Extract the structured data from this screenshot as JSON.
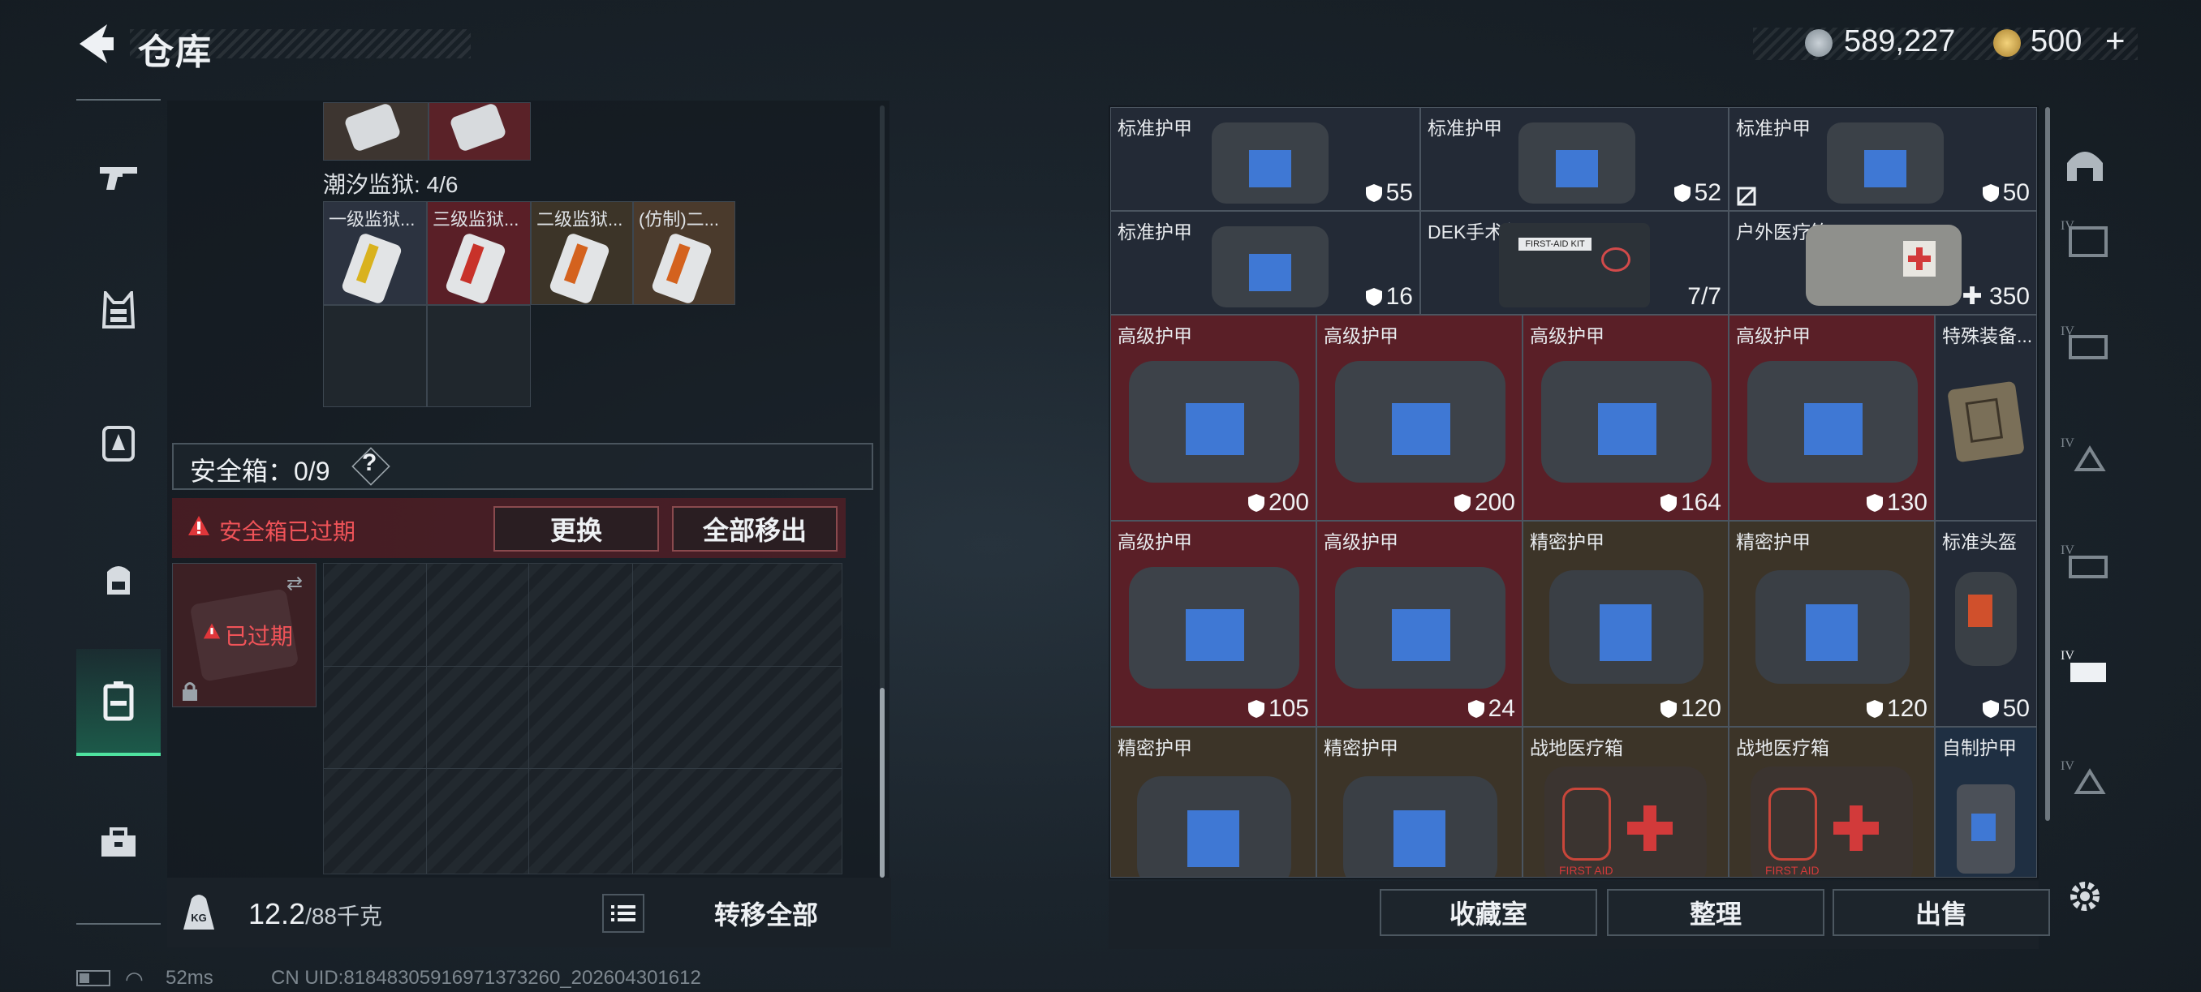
{
  "header": {
    "title": "仓库",
    "currency_silver": "589,227",
    "currency_gold": "500"
  },
  "sidebar": {
    "items": [
      "gun-icon",
      "vest-icon",
      "chest-rig-icon",
      "backpack-icon",
      "safe-box-icon",
      "toolbox-icon"
    ]
  },
  "left": {
    "prison_label": "潮汐监狱: 4/6",
    "cards": [
      "一级监狱...",
      "三级监狱...",
      "二级监狱...",
      "(仿制)二..."
    ],
    "safebox_label": "安全箱：0/9",
    "help": "?",
    "expired_warning": "安全箱已过期",
    "replace_button": "更换",
    "remove_all_button": "全部移出",
    "expired_tag": "已过期",
    "weight_current": "12.2",
    "weight_total": "/88千克",
    "transfer_all_button": "转移全部",
    "weight_icon": "KG"
  },
  "status": {
    "ping": "52ms",
    "uid": "CN UID:81848305916971373260_202604301612"
  },
  "inventory": {
    "row1": [
      {
        "name": "标准护甲",
        "value": "55"
      },
      {
        "name": "标准护甲",
        "value": "52"
      },
      {
        "name": "标准护甲",
        "value": "50"
      }
    ],
    "row2": [
      {
        "name": "标准护甲",
        "value": "16"
      },
      {
        "name": "DEK手术包",
        "value": "7/7",
        "badge": "FIRST-AID KIT"
      },
      {
        "name": "户外医疗箱",
        "value": "350"
      }
    ],
    "row3": [
      {
        "name": "高级护甲",
        "value": "200"
      },
      {
        "name": "高级护甲",
        "value": "200"
      },
      {
        "name": "高级护甲",
        "value": "164"
      },
      {
        "name": "高级护甲",
        "value": "130"
      },
      {
        "name": "特殊装备..."
      }
    ],
    "row4": [
      {
        "name": "高级护甲",
        "value": "105"
      },
      {
        "name": "高级护甲",
        "value": "24"
      },
      {
        "name": "精密护甲",
        "value": "120"
      },
      {
        "name": "精密护甲",
        "value": "120"
      },
      {
        "name": "标准头盔",
        "value": "50"
      }
    ],
    "row5": [
      {
        "name": "精密护甲"
      },
      {
        "name": "精密护甲"
      },
      {
        "name": "战地医疗箱"
      },
      {
        "name": "战地医疗箱"
      },
      {
        "name": "自制护甲"
      }
    ],
    "medkit_label": "FIRST AID"
  },
  "footer": {
    "collection_button": "收藏室",
    "sort_button": "整理",
    "sell_button": "出售"
  }
}
